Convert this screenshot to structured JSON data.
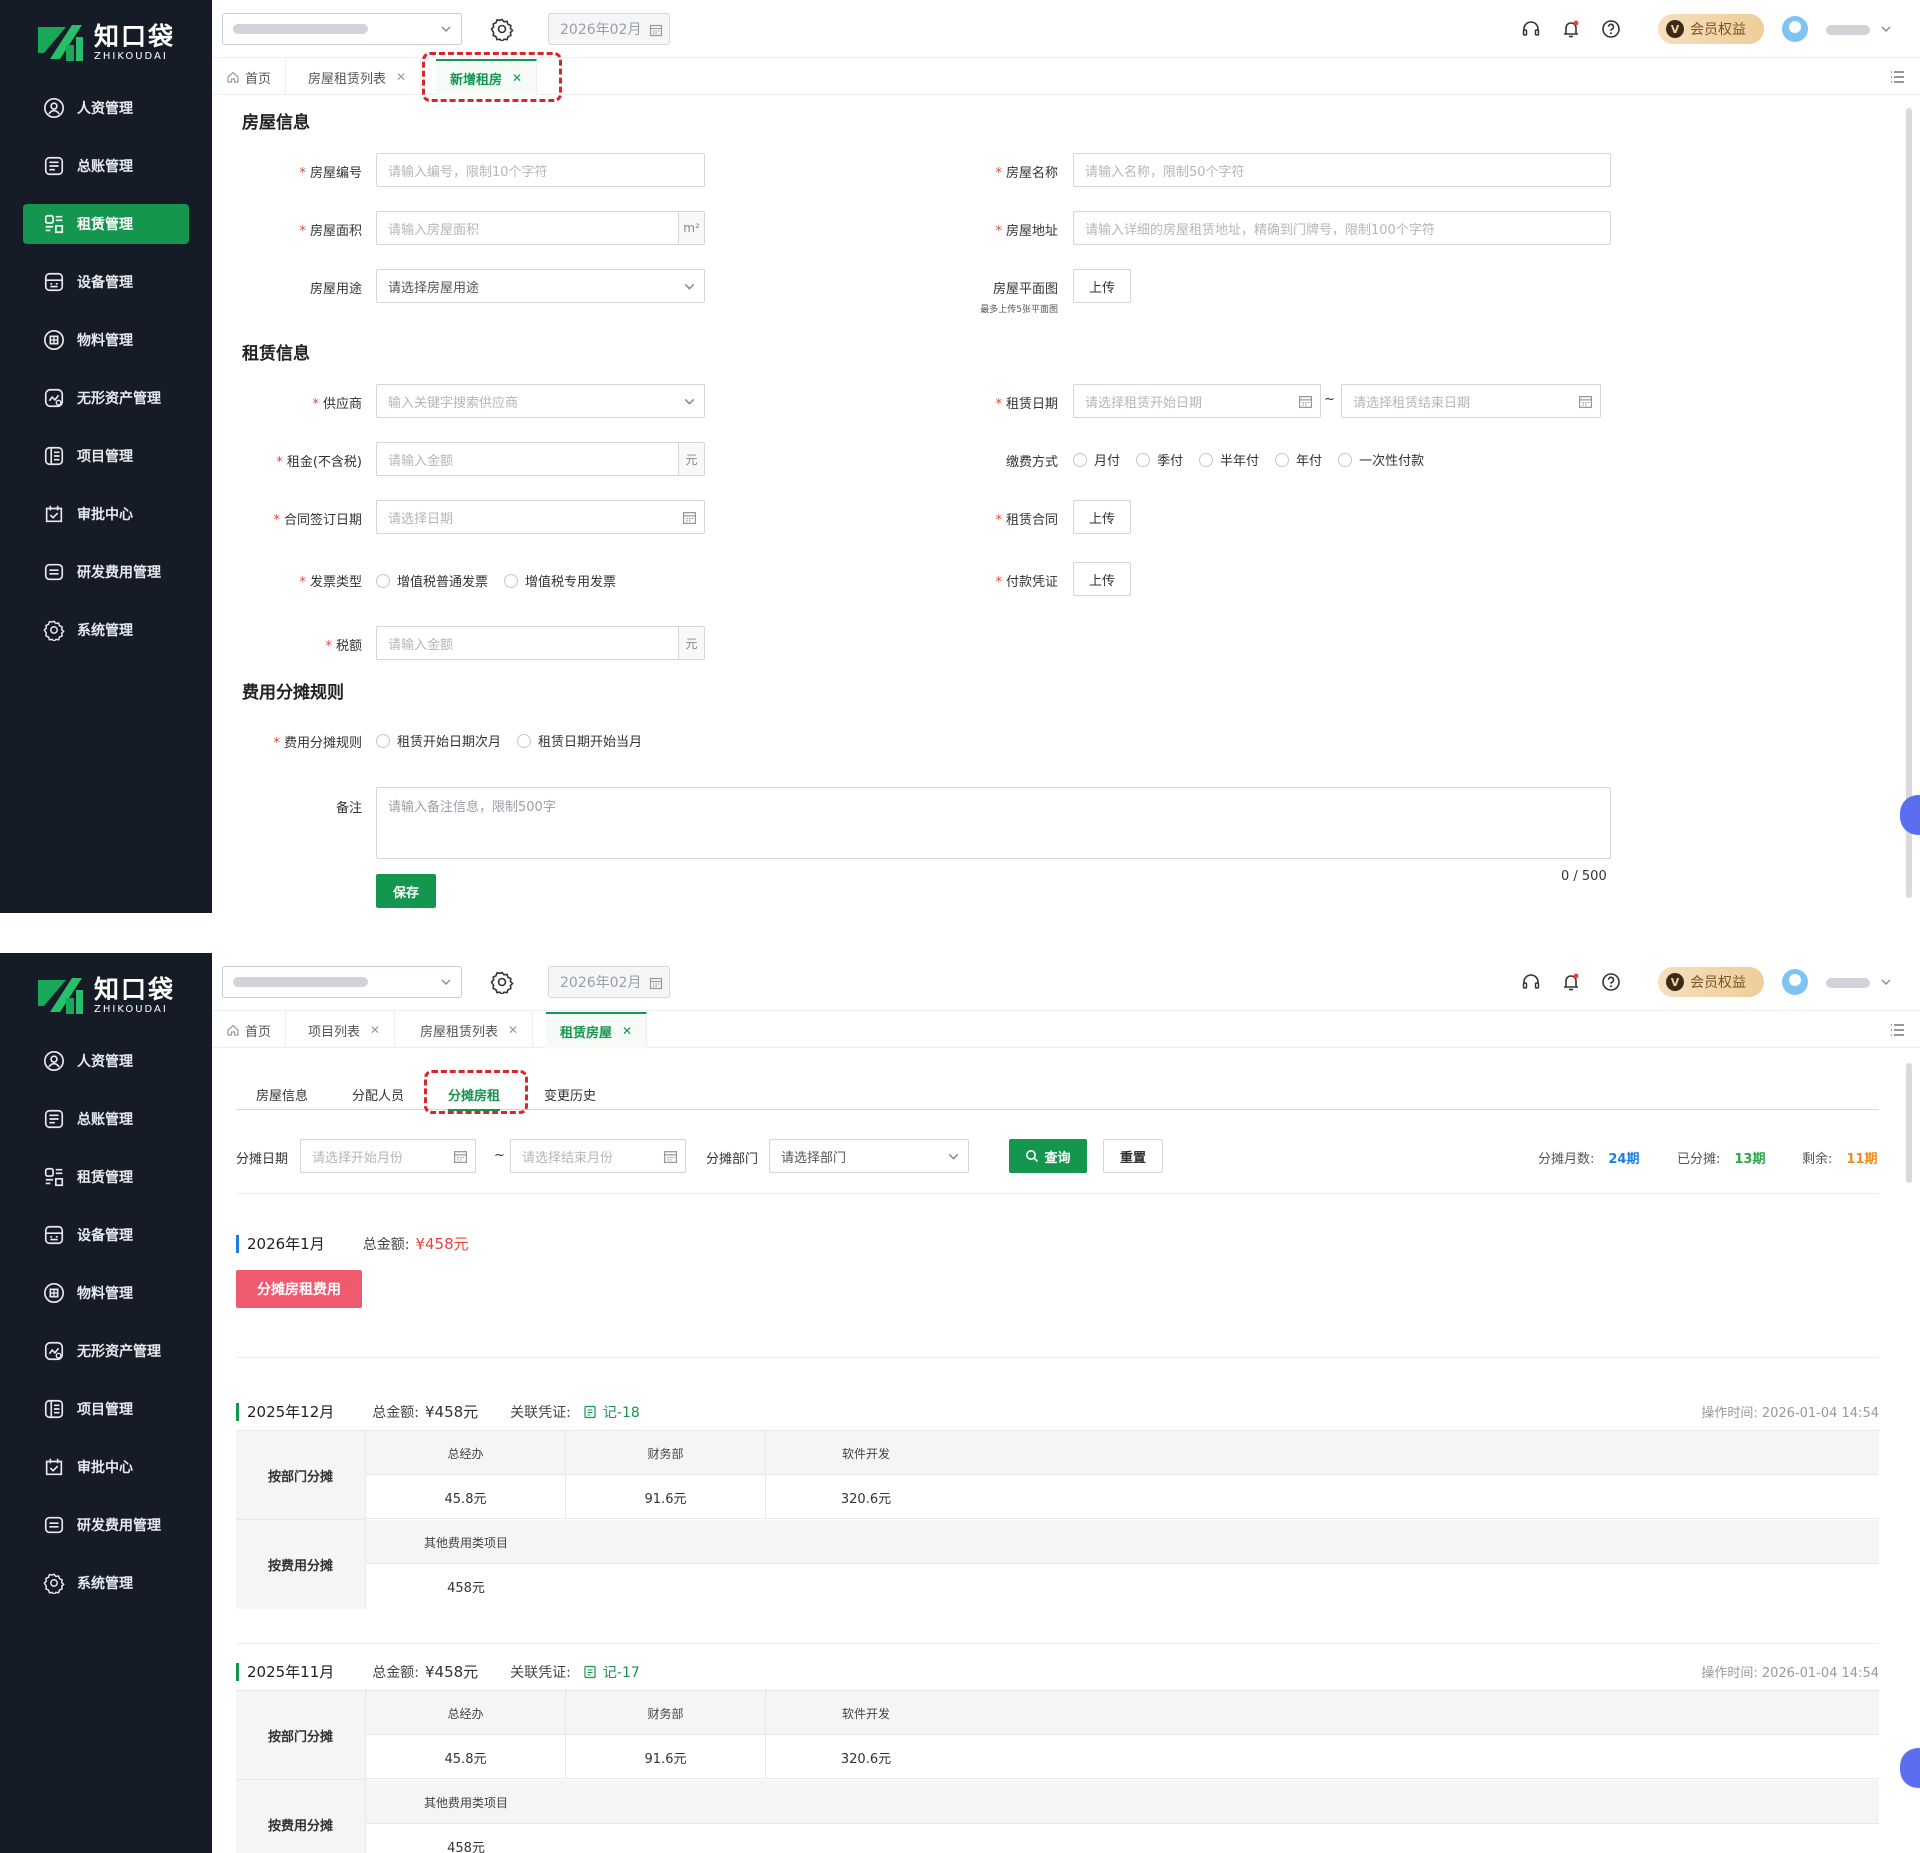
{
  "brand": {
    "name_cn": "知口袋",
    "name_en": "ZHIKOUDAI",
    "green": "#15964f",
    "sidebar_bg": "#161c27"
  },
  "sidebar": {
    "items": [
      {
        "label": "人资管理",
        "icon": "person-circle-icon"
      },
      {
        "label": "总账管理",
        "icon": "ledger-icon"
      },
      {
        "label": "租赁管理",
        "icon": "lease-icon"
      },
      {
        "label": "设备管理",
        "icon": "device-icon"
      },
      {
        "label": "物料管理",
        "icon": "material-icon"
      },
      {
        "label": "无形资产管理",
        "icon": "intangible-asset-icon"
      },
      {
        "label": "项目管理",
        "icon": "project-icon"
      },
      {
        "label": "审批中心",
        "icon": "approval-icon"
      },
      {
        "label": "研发费用管理",
        "icon": "rd-expense-icon"
      },
      {
        "label": "系统管理",
        "icon": "gear-icon"
      }
    ]
  },
  "topbar": {
    "month": "2026年02月",
    "vip_badge": "V",
    "vip_label": "会员权益"
  },
  "screen1": {
    "tabs": [
      "首页",
      "房屋租赁列表",
      "新增租房"
    ],
    "sections": {
      "house": "房屋信息",
      "lease": "租赁信息",
      "alloc": "费用分摊规则"
    },
    "fields": {
      "house_no": {
        "label": "房屋编号",
        "placeholder": "请输入编号，限制10个字符"
      },
      "house_name": {
        "label": "房屋名称",
        "placeholder": "请输入名称，限制50个字符"
      },
      "house_area": {
        "label": "房屋面积",
        "placeholder": "请输入房屋面积",
        "suffix": "m²"
      },
      "house_addr": {
        "label": "房屋地址",
        "placeholder": "请输入详细的房屋租赁地址，精确到门牌号，限制100个字符"
      },
      "house_use": {
        "label": "房屋用途",
        "placeholder": "请选择房屋用途"
      },
      "floor_plan": {
        "label": "房屋平面图",
        "hint": "最多上传5张平面图",
        "button": "上传"
      },
      "supplier": {
        "label": "供应商",
        "placeholder": "输入关键字搜索供应商"
      },
      "lease_date": {
        "label": "租赁日期",
        "start_placeholder": "请选择租赁开始日期",
        "sep": "~",
        "end_placeholder": "请选择租赁结束日期"
      },
      "rent": {
        "label": "租金(不含税)",
        "placeholder": "请输入金额",
        "suffix": "元"
      },
      "pay_mode": {
        "label": "缴费方式",
        "options": [
          "月付",
          "季付",
          "半年付",
          "年付",
          "一次性付款"
        ]
      },
      "sign_date": {
        "label": "合同签订日期",
        "placeholder": "请选择日期"
      },
      "contract": {
        "label": "租赁合同",
        "button": "上传"
      },
      "invoice_type": {
        "label": "发票类型",
        "options": [
          "增值税普通发票",
          "增值税专用发票"
        ]
      },
      "pay_voucher": {
        "label": "付款凭证",
        "button": "上传"
      },
      "tax": {
        "label": "税额",
        "placeholder": "请输入金额",
        "suffix": "元"
      },
      "alloc_rule": {
        "label": "费用分摊规则",
        "options": [
          "租赁开始日期次月",
          "租赁日期开始当月"
        ]
      },
      "remark": {
        "label": "备注",
        "placeholder": "请输入备注信息，限制500字",
        "counter": "0 / 500"
      }
    },
    "save_button": "保存"
  },
  "screen2": {
    "tabs": [
      "首页",
      "项目列表",
      "房屋租赁列表",
      "租赁房屋"
    ],
    "subtabs": [
      "房屋信息",
      "分配人员",
      "分摊房租",
      "变更历史"
    ],
    "filters": {
      "date_label": "分摊日期",
      "start_placeholder": "请选择开始月份",
      "sep": "~",
      "end_placeholder": "请选择结束月份",
      "dept_label": "分摊部门",
      "dept_placeholder": "请选择部门",
      "query": "查询",
      "reset": "重置"
    },
    "stats": [
      {
        "label": "分摊月数:",
        "value": "24期",
        "color": "#1f7fe0"
      },
      {
        "label": "已分摊:",
        "value": "13期",
        "color": "#2aa84a"
      },
      {
        "label": "剩余:",
        "value": "11期",
        "color": "#f08c1a"
      }
    ],
    "pending": {
      "month": "2026年1月",
      "total_label": "总金额:",
      "total": "¥458元",
      "button": "分摊房租费用"
    },
    "records": [
      {
        "month": "2025年12月",
        "total_label": "总金额:",
        "total": "¥458元",
        "voucher_label": "关联凭证:",
        "voucher": "记-18",
        "optime": "操作时间: 2026-01-04 14:54",
        "dept_group": "按部门分摊",
        "depts": [
          "总经办",
          "财务部",
          "软件开发"
        ],
        "dept_values": [
          "45.8元",
          "91.6元",
          "320.6元"
        ],
        "fee_group": "按费用分摊",
        "fees": [
          "其他费用类项目"
        ],
        "fee_values": [
          "458元"
        ]
      },
      {
        "month": "2025年11月",
        "total_label": "总金额:",
        "total": "¥458元",
        "voucher_label": "关联凭证:",
        "voucher": "记-17",
        "optime": "操作时间: 2026-01-04 14:54",
        "dept_group": "按部门分摊",
        "depts": [
          "总经办",
          "财务部",
          "软件开发"
        ],
        "dept_values": [
          "45.8元",
          "91.6元",
          "320.6元"
        ],
        "fee_group": "按费用分摊",
        "fees": [
          "其他费用类项目"
        ],
        "fee_values": [
          "458元"
        ]
      }
    ]
  }
}
